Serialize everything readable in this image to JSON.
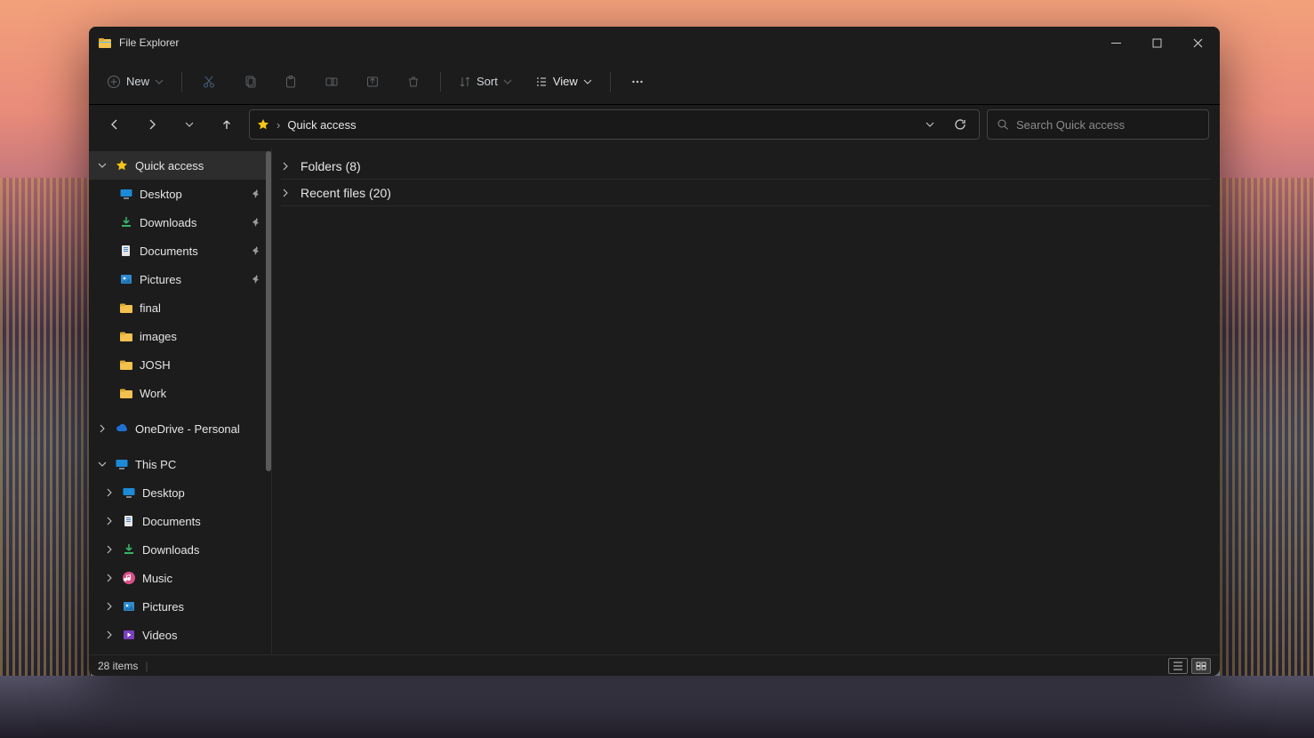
{
  "window": {
    "title": "File Explorer"
  },
  "toolbar": {
    "new_label": "New",
    "sort_label": "Sort",
    "view_label": "View"
  },
  "address": {
    "location": "Quick access"
  },
  "search": {
    "placeholder": "Search Quick access"
  },
  "sidebar": {
    "quick_access": {
      "label": "Quick access",
      "items": [
        {
          "label": "Desktop",
          "pinned": true
        },
        {
          "label": "Downloads",
          "pinned": true
        },
        {
          "label": "Documents",
          "pinned": true
        },
        {
          "label": "Pictures",
          "pinned": true
        },
        {
          "label": "final",
          "pinned": false
        },
        {
          "label": "images",
          "pinned": false
        },
        {
          "label": "JOSH",
          "pinned": false
        },
        {
          "label": "Work",
          "pinned": false
        }
      ]
    },
    "onedrive": {
      "label": "OneDrive - Personal"
    },
    "this_pc": {
      "label": "This PC",
      "items": [
        {
          "label": "Desktop"
        },
        {
          "label": "Documents"
        },
        {
          "label": "Downloads"
        },
        {
          "label": "Music"
        },
        {
          "label": "Pictures"
        },
        {
          "label": "Videos"
        }
      ]
    }
  },
  "content": {
    "groups": [
      {
        "label": "Folders (8)"
      },
      {
        "label": "Recent files (20)"
      }
    ]
  },
  "status": {
    "items_text": "28 items"
  }
}
